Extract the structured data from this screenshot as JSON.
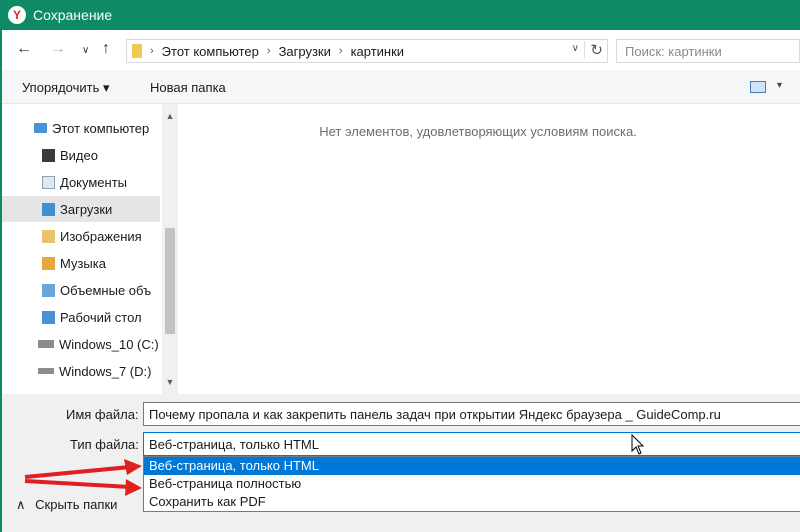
{
  "window": {
    "title": "Сохранение",
    "accent": "#0e8a66"
  },
  "nav": {
    "back_icon": "←",
    "forward_icon": "→",
    "recent_icon": "∨",
    "up_icon": "↑",
    "breadcrumb": [
      "Этот компьютер",
      "Загрузки",
      "картинки"
    ],
    "separator": "›",
    "address_dropdown_icon": "∨",
    "refresh_icon": "↻",
    "search_placeholder": "Поиск: картинки"
  },
  "toolbar": {
    "organize_label": "Упорядочить ▾",
    "new_folder_label": "Новая папка",
    "view_dropdown_icon": "▾"
  },
  "sidebar": {
    "items": [
      {
        "label": "Этот компьютер",
        "icon": "computer-icon",
        "color": "#4a90d9"
      },
      {
        "label": "Видео",
        "icon": "video-folder-icon",
        "color": "#3b3b3b"
      },
      {
        "label": "Документы",
        "icon": "documents-folder-icon",
        "color": "#dfe7ef"
      },
      {
        "label": "Загрузки",
        "icon": "downloads-folder-icon",
        "color": "#3d8fd6"
      },
      {
        "label": "Изображения",
        "icon": "pictures-folder-icon",
        "color": "#e8c36a"
      },
      {
        "label": "Музыка",
        "icon": "music-folder-icon",
        "color": "#e8a73d"
      },
      {
        "label": "Объемные объ",
        "icon": "3d-objects-folder-icon",
        "color": "#6aa7d8"
      },
      {
        "label": "Рабочий стол",
        "icon": "desktop-folder-icon",
        "color": "#4a90d9"
      },
      {
        "label": "Windows_10 (C:)",
        "icon": "drive-icon",
        "color": "#8c8c8c"
      },
      {
        "label": "Windows_7 (D:)",
        "icon": "drive-icon",
        "color": "#8c8c8c"
      }
    ],
    "selected_index": 3,
    "scroll_up_icon": "▲",
    "scroll_down_icon": "▼"
  },
  "content": {
    "empty_message": "Нет элементов, удовлетворяющих условиям поиска."
  },
  "form": {
    "filename_label": "Имя файла:",
    "filename_value": "Почему пропала и как закрепить панель задач при открытии Яндекс браузера _ GuideComp.ru",
    "filetype_label": "Тип файла:",
    "filetype_value": "Веб-страница, только HTML",
    "filetype_options": [
      "Веб-страница, только HTML",
      "Веб-страница полностью",
      "Сохранить как PDF"
    ],
    "highlighted_option": 0
  },
  "footer": {
    "hide_folders_label": "Скрыть папки",
    "hide_folders_icon": "∧"
  },
  "annotation_color": "#e02020"
}
